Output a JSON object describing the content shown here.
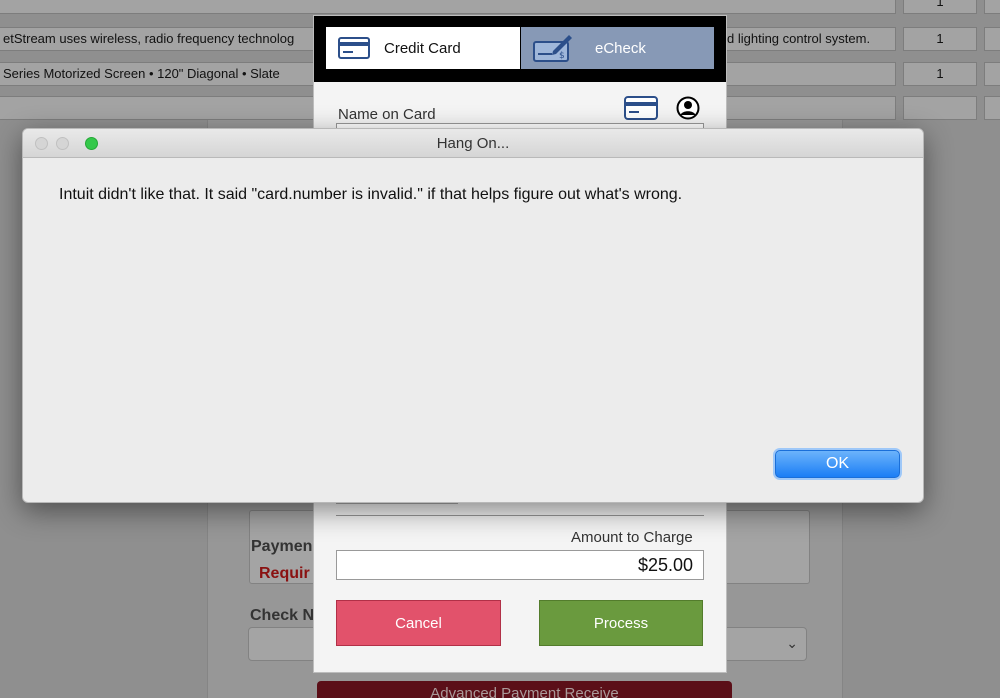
{
  "table": {
    "rows": [
      {
        "description": "",
        "quantity": "1"
      },
      {
        "description": "etStream uses wireless, radio frequency technolog",
        "description_tail": "d lighting control system.",
        "quantity": "1"
      },
      {
        "description": "Series Motorized Screen • 120\" Diagonal • Slate",
        "quantity": "1"
      },
      {
        "description": "",
        "quantity": ""
      }
    ]
  },
  "form": {
    "payment_label": "Paymen",
    "required_label": "Requir",
    "check_label": "Check N",
    "advanced_button": "Advanced Payment Receive"
  },
  "payment_modal": {
    "tabs": {
      "credit_card": "Credit Card",
      "echeck": "eCheck"
    },
    "name_on_card_label": "Name on Card",
    "amount_label": "Amount to Charge",
    "amount_value": "$25.00",
    "cancel_label": "Cancel",
    "process_label": "Process"
  },
  "alert": {
    "title": "Hang On...",
    "message": "Intuit didn't like that. It said \"card.number is invalid.\" if that helps figure out what's wrong.",
    "ok_label": "OK"
  },
  "colors": {
    "accent_blue": "#1b7ef5",
    "cancel_red": "#e2526b",
    "process_green": "#6a9a3e",
    "echeck_tab": "#8799b6"
  }
}
